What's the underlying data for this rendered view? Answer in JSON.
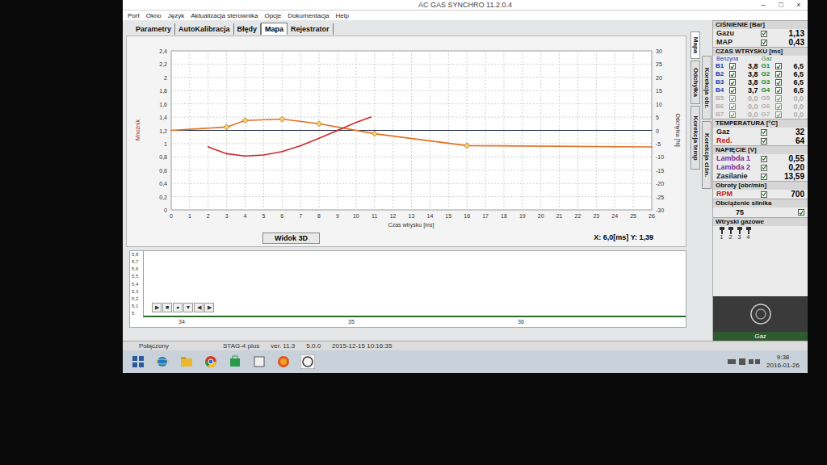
{
  "window": {
    "title": "AC GAS SYNCHRO 11.2.0.4",
    "controls": [
      "–",
      "□",
      "×"
    ]
  },
  "menu": [
    "Port",
    "Okno",
    "Język",
    "Aktualizacja sterownika",
    "Opcje",
    "Dokumentacja",
    "Help"
  ],
  "tabs": [
    {
      "label": "Parametry",
      "selected": false
    },
    {
      "label": "AutoKalibracja",
      "selected": false
    },
    {
      "label": "Błędy",
      "selected": false
    },
    {
      "label": "Mapa",
      "selected": true
    },
    {
      "label": "Rejestrator",
      "selected": false
    }
  ],
  "chart": {
    "y_left_title": "Mnożnik",
    "y_right_title": "Odchyłka [%]",
    "x_title": "Czas wtrysku [ms]",
    "x_ticks": [
      "0",
      "1",
      "2",
      "3",
      "4",
      "5",
      "6",
      "7",
      "8",
      "9",
      "10",
      "11",
      "12",
      "13",
      "14",
      "15",
      "16",
      "17",
      "18",
      "19",
      "20",
      "21",
      "22",
      "23",
      "24",
      "25",
      "26"
    ],
    "y_left_ticks": [
      "0",
      "0,2",
      "0,4",
      "0,6",
      "0,8",
      "1",
      "1,2",
      "1,4",
      "1,6",
      "1,8",
      "2",
      "2,2",
      "2,4"
    ],
    "y_right_ticks": [
      "-30",
      "-25",
      "-20",
      "-15",
      "-10",
      "-5",
      "0",
      "5",
      "10",
      "15",
      "20",
      "25",
      "30"
    ],
    "zero_line": {
      "axis": "right",
      "value": 0
    },
    "series": [
      {
        "name": "map",
        "axis": "left",
        "color": "#e0701e",
        "points": [
          {
            "x": 0,
            "y": 1.2,
            "marker": false
          },
          {
            "x": 3,
            "y": 1.25,
            "marker": true
          },
          {
            "x": 4,
            "y": 1.35,
            "marker": true
          },
          {
            "x": 6,
            "y": 1.37,
            "marker": true
          },
          {
            "x": 8,
            "y": 1.3,
            "marker": true
          },
          {
            "x": 11,
            "y": 1.15,
            "marker": true
          },
          {
            "x": 16,
            "y": 0.97,
            "marker": true
          },
          {
            "x": 26,
            "y": 0.95,
            "marker": false
          }
        ]
      },
      {
        "name": "deviation",
        "axis": "right",
        "color": "#d02a2a",
        "points": [
          {
            "x": 2,
            "y": -6.2,
            "marker": false
          },
          {
            "x": 3,
            "y": -8.8,
            "marker": false
          },
          {
            "x": 4,
            "y": -9.7,
            "marker": false
          },
          {
            "x": 5,
            "y": -9.3,
            "marker": false
          },
          {
            "x": 6,
            "y": -8,
            "marker": false
          },
          {
            "x": 7,
            "y": -5.8,
            "marker": false
          },
          {
            "x": 8,
            "y": -3,
            "marker": false
          },
          {
            "x": 9,
            "y": 0,
            "marker": false
          },
          {
            "x": 10,
            "y": 3,
            "marker": false
          },
          {
            "x": 10.8,
            "y": 5,
            "marker": false
          }
        ]
      }
    ],
    "view_button": "Widok 3D",
    "cursor": "X: 6,0[ms] Y: 1,39"
  },
  "side_tabs": [
    {
      "label": "Mapa",
      "selected": true
    },
    {
      "label": "Korekcja obr.",
      "selected": false
    },
    {
      "label": "Odchyłka",
      "selected": false
    },
    {
      "label": "Korekcja ciśn.",
      "selected": false
    },
    {
      "label": "Korekcja temp",
      "selected": false
    }
  ],
  "panel": {
    "pressure": {
      "title": "CIŚNIENIE [Bar]",
      "rows": [
        {
          "label": "Gazu",
          "checked": true,
          "value": "1,13",
          "color": "#1a1a1a"
        },
        {
          "label": "MAP",
          "checked": true,
          "value": "0,43",
          "color": "#1a1a1a"
        }
      ]
    },
    "injection": {
      "title": "CZAS WTRYSKU [ms]",
      "petrol_heading": "Benzyna",
      "gas_heading": "Gaz",
      "rows": [
        {
          "disabled": false,
          "petrol": {
            "label": "B1",
            "checked": true,
            "value": "3,8"
          },
          "gas": {
            "label": "G1",
            "checked": true,
            "value": "6,5"
          }
        },
        {
          "disabled": false,
          "petrol": {
            "label": "B2",
            "checked": true,
            "value": "3,8"
          },
          "gas": {
            "label": "G2",
            "checked": true,
            "value": "6,5"
          }
        },
        {
          "disabled": false,
          "petrol": {
            "label": "B3",
            "checked": true,
            "value": "3,8"
          },
          "gas": {
            "label": "G3",
            "checked": true,
            "value": "6,5"
          }
        },
        {
          "disabled": false,
          "petrol": {
            "label": "B4",
            "checked": true,
            "value": "3,7"
          },
          "gas": {
            "label": "G4",
            "checked": true,
            "value": "6,5"
          }
        },
        {
          "disabled": true,
          "petrol": {
            "label": "B5",
            "checked": true,
            "value": "0,0"
          },
          "gas": {
            "label": "G5",
            "checked": true,
            "value": "0,0"
          }
        },
        {
          "disabled": true,
          "petrol": {
            "label": "B6",
            "checked": true,
            "value": "0,0"
          },
          "gas": {
            "label": "G6",
            "checked": true,
            "value": "0,0"
          }
        },
        {
          "disabled": true,
          "petrol": {
            "label": "B7",
            "checked": true,
            "value": "0,0"
          },
          "gas": {
            "label": "G7",
            "checked": true,
            "value": "0,0"
          }
        }
      ]
    },
    "temperature": {
      "title": "TEMPERATURA [°C]",
      "rows": [
        {
          "label": "Gaz",
          "checked": true,
          "value": "32",
          "color": "#1a1a1a"
        },
        {
          "label": "Red.",
          "checked": true,
          "value": "64",
          "color": "#c0221e"
        }
      ]
    },
    "voltage": {
      "title": "NAPIĘCIE [V]",
      "rows": [
        {
          "label": "Lambda 1",
          "checked": true,
          "value": "0,55",
          "color": "#7a2a9a"
        },
        {
          "label": "Lambda 2",
          "checked": true,
          "value": "0,20",
          "color": "#7a2a9a"
        },
        {
          "label": "Zasilanie",
          "checked": true,
          "value": "13,59",
          "color": "#1a1a1a"
        }
      ]
    },
    "rpm": {
      "title": "Obroty [obr/min]",
      "rows": [
        {
          "label": "RPM",
          "checked": true,
          "value": "700",
          "color": "#c0221e"
        }
      ]
    },
    "load": {
      "title": "Obciążenie silnika",
      "value": "75",
      "checked": true
    },
    "injectors": {
      "title": "Wtryski gazowe",
      "items": [
        {
          "label": "1",
          "active": true
        },
        {
          "label": "2",
          "active": true
        },
        {
          "label": "3",
          "active": true
        },
        {
          "label": "4",
          "active": true
        }
      ]
    },
    "logo_status": "Gaz"
  },
  "recorder": {
    "y_ticks": [
      "5,8",
      "5,7",
      "5,6",
      "5,5",
      "5,4",
      "5,3",
      "5,2",
      "5,1",
      "5"
    ],
    "x_ticks": [
      "34",
      "35",
      "36"
    ],
    "controls": [
      "▶",
      "■",
      "●",
      "▼",
      "◀",
      "▶"
    ]
  },
  "status_bar": {
    "connection": "Połączony",
    "device": "STAG-4 plus",
    "version": "ver. 11.3",
    "firmware": "5.0.0",
    "date": "2015-12-15 10:16:35"
  },
  "taskbar": {
    "time": "9:38",
    "date": "2016-01-26"
  }
}
